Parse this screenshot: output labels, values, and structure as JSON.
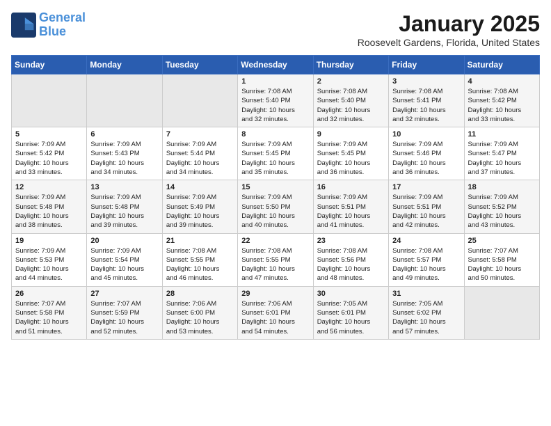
{
  "logo": {
    "line1": "General",
    "line2": "Blue"
  },
  "title": "January 2025",
  "subtitle": "Roosevelt Gardens, Florida, United States",
  "days_of_week": [
    "Sunday",
    "Monday",
    "Tuesday",
    "Wednesday",
    "Thursday",
    "Friday",
    "Saturday"
  ],
  "weeks": [
    [
      {
        "day": "",
        "info": ""
      },
      {
        "day": "",
        "info": ""
      },
      {
        "day": "",
        "info": ""
      },
      {
        "day": "1",
        "info": "Sunrise: 7:08 AM\nSunset: 5:40 PM\nDaylight: 10 hours\nand 32 minutes."
      },
      {
        "day": "2",
        "info": "Sunrise: 7:08 AM\nSunset: 5:40 PM\nDaylight: 10 hours\nand 32 minutes."
      },
      {
        "day": "3",
        "info": "Sunrise: 7:08 AM\nSunset: 5:41 PM\nDaylight: 10 hours\nand 32 minutes."
      },
      {
        "day": "4",
        "info": "Sunrise: 7:08 AM\nSunset: 5:42 PM\nDaylight: 10 hours\nand 33 minutes."
      }
    ],
    [
      {
        "day": "5",
        "info": "Sunrise: 7:09 AM\nSunset: 5:42 PM\nDaylight: 10 hours\nand 33 minutes."
      },
      {
        "day": "6",
        "info": "Sunrise: 7:09 AM\nSunset: 5:43 PM\nDaylight: 10 hours\nand 34 minutes."
      },
      {
        "day": "7",
        "info": "Sunrise: 7:09 AM\nSunset: 5:44 PM\nDaylight: 10 hours\nand 34 minutes."
      },
      {
        "day": "8",
        "info": "Sunrise: 7:09 AM\nSunset: 5:45 PM\nDaylight: 10 hours\nand 35 minutes."
      },
      {
        "day": "9",
        "info": "Sunrise: 7:09 AM\nSunset: 5:45 PM\nDaylight: 10 hours\nand 36 minutes."
      },
      {
        "day": "10",
        "info": "Sunrise: 7:09 AM\nSunset: 5:46 PM\nDaylight: 10 hours\nand 36 minutes."
      },
      {
        "day": "11",
        "info": "Sunrise: 7:09 AM\nSunset: 5:47 PM\nDaylight: 10 hours\nand 37 minutes."
      }
    ],
    [
      {
        "day": "12",
        "info": "Sunrise: 7:09 AM\nSunset: 5:48 PM\nDaylight: 10 hours\nand 38 minutes."
      },
      {
        "day": "13",
        "info": "Sunrise: 7:09 AM\nSunset: 5:48 PM\nDaylight: 10 hours\nand 39 minutes."
      },
      {
        "day": "14",
        "info": "Sunrise: 7:09 AM\nSunset: 5:49 PM\nDaylight: 10 hours\nand 39 minutes."
      },
      {
        "day": "15",
        "info": "Sunrise: 7:09 AM\nSunset: 5:50 PM\nDaylight: 10 hours\nand 40 minutes."
      },
      {
        "day": "16",
        "info": "Sunrise: 7:09 AM\nSunset: 5:51 PM\nDaylight: 10 hours\nand 41 minutes."
      },
      {
        "day": "17",
        "info": "Sunrise: 7:09 AM\nSunset: 5:51 PM\nDaylight: 10 hours\nand 42 minutes."
      },
      {
        "day": "18",
        "info": "Sunrise: 7:09 AM\nSunset: 5:52 PM\nDaylight: 10 hours\nand 43 minutes."
      }
    ],
    [
      {
        "day": "19",
        "info": "Sunrise: 7:09 AM\nSunset: 5:53 PM\nDaylight: 10 hours\nand 44 minutes."
      },
      {
        "day": "20",
        "info": "Sunrise: 7:09 AM\nSunset: 5:54 PM\nDaylight: 10 hours\nand 45 minutes."
      },
      {
        "day": "21",
        "info": "Sunrise: 7:08 AM\nSunset: 5:55 PM\nDaylight: 10 hours\nand 46 minutes."
      },
      {
        "day": "22",
        "info": "Sunrise: 7:08 AM\nSunset: 5:55 PM\nDaylight: 10 hours\nand 47 minutes."
      },
      {
        "day": "23",
        "info": "Sunrise: 7:08 AM\nSunset: 5:56 PM\nDaylight: 10 hours\nand 48 minutes."
      },
      {
        "day": "24",
        "info": "Sunrise: 7:08 AM\nSunset: 5:57 PM\nDaylight: 10 hours\nand 49 minutes."
      },
      {
        "day": "25",
        "info": "Sunrise: 7:07 AM\nSunset: 5:58 PM\nDaylight: 10 hours\nand 50 minutes."
      }
    ],
    [
      {
        "day": "26",
        "info": "Sunrise: 7:07 AM\nSunset: 5:58 PM\nDaylight: 10 hours\nand 51 minutes."
      },
      {
        "day": "27",
        "info": "Sunrise: 7:07 AM\nSunset: 5:59 PM\nDaylight: 10 hours\nand 52 minutes."
      },
      {
        "day": "28",
        "info": "Sunrise: 7:06 AM\nSunset: 6:00 PM\nDaylight: 10 hours\nand 53 minutes."
      },
      {
        "day": "29",
        "info": "Sunrise: 7:06 AM\nSunset: 6:01 PM\nDaylight: 10 hours\nand 54 minutes."
      },
      {
        "day": "30",
        "info": "Sunrise: 7:05 AM\nSunset: 6:01 PM\nDaylight: 10 hours\nand 56 minutes."
      },
      {
        "day": "31",
        "info": "Sunrise: 7:05 AM\nSunset: 6:02 PM\nDaylight: 10 hours\nand 57 minutes."
      },
      {
        "day": "",
        "info": ""
      }
    ]
  ]
}
